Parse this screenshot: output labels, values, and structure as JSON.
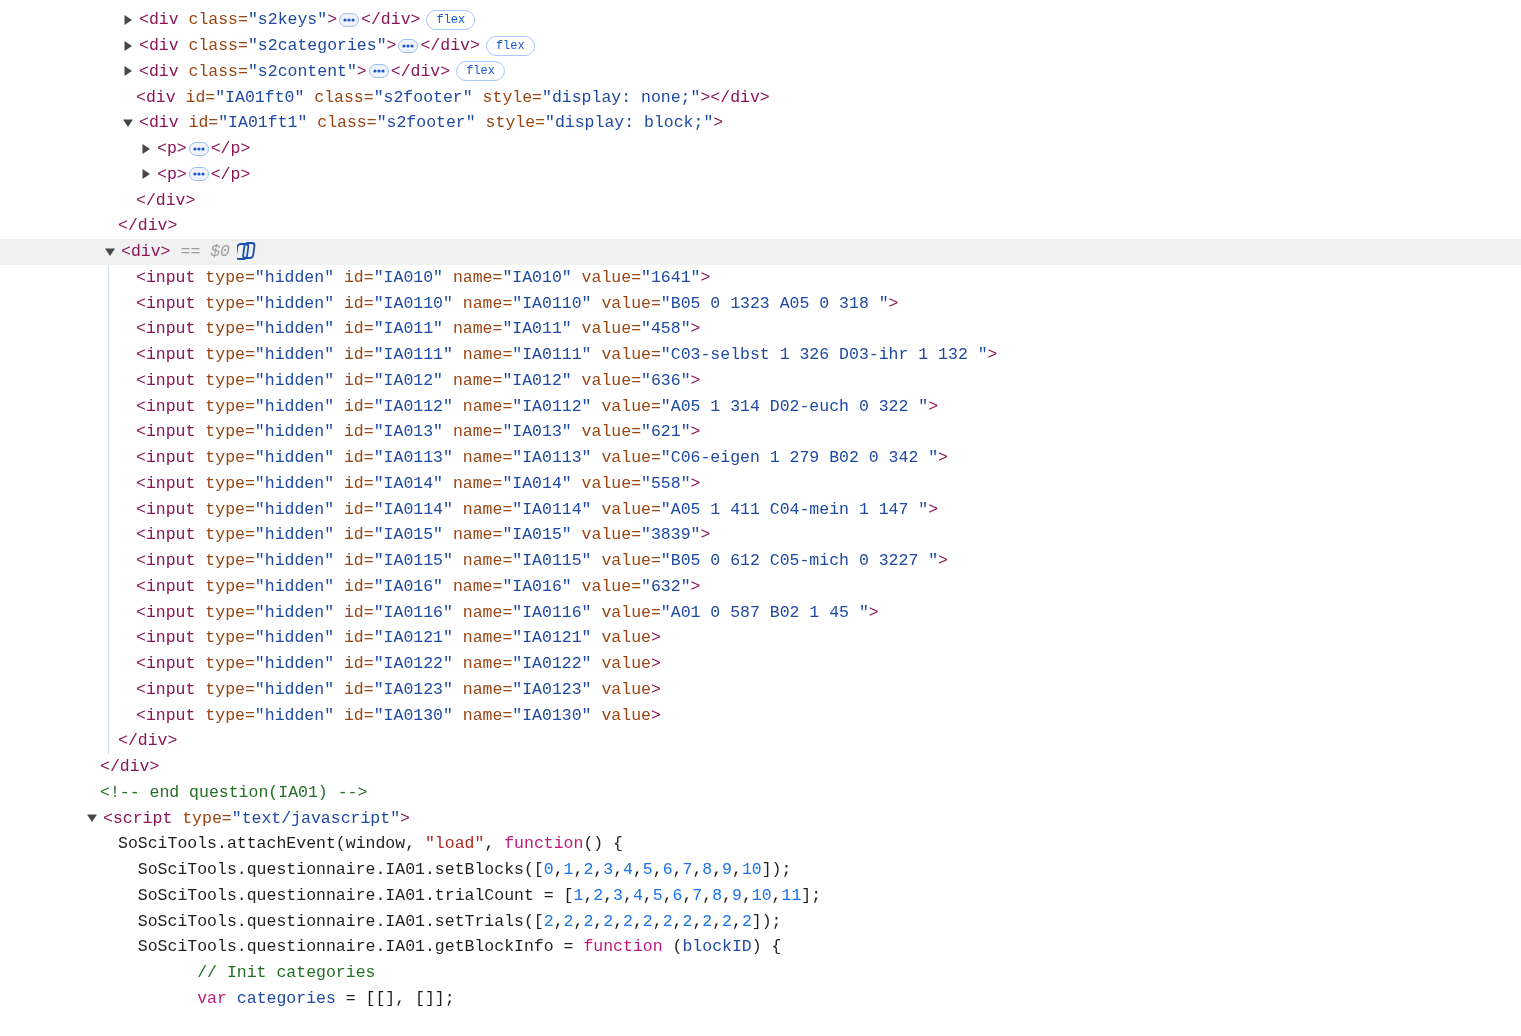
{
  "nodes": [
    {
      "kind": "fragment",
      "close": "</div>",
      "children": [
        {
          "kind": "fragment",
          "close": "</div>",
          "children": [
            {
              "kind": "element",
              "expanded": false,
              "selected": false,
              "open": "<div class=\"s2keys\">",
              "close": "</div>",
              "badge": "flex"
            },
            {
              "kind": "element",
              "expanded": false,
              "selected": false,
              "open": "<div class=\"s2categories\">",
              "close": "</div>",
              "badge": "flex"
            },
            {
              "kind": "element",
              "expanded": false,
              "selected": false,
              "open": "<div class=\"s2content\">",
              "close": "</div>",
              "badge": "flex"
            },
            {
              "kind": "leaf",
              "selected": false,
              "open": "<div id=\"IA01ft0\" class=\"s2footer\" style=\"display: none;\">",
              "close": "</div>"
            },
            {
              "kind": "element",
              "expanded": true,
              "selected": false,
              "open": "<div id=\"IA01ft1\" class=\"s2footer\" style=\"display: block;\">",
              "close": "</div>",
              "children": [
                {
                  "kind": "element",
                  "expanded": false,
                  "selected": false,
                  "open": "<p>",
                  "close": "</p>"
                },
                {
                  "kind": "element",
                  "expanded": false,
                  "selected": false,
                  "open": "<p>",
                  "close": "</p>"
                }
              ]
            }
          ]
        },
        {
          "kind": "element",
          "expanded": true,
          "selected": true,
          "open": "<div>",
          "marker": "== $0",
          "close": "</div>",
          "children": [
            {
              "kind": "leaf",
              "selected": false,
              "open": "<input type=\"hidden\" id=\"IA010\" name=\"IA010\" value=\"1641\">"
            },
            {
              "kind": "leaf",
              "selected": false,
              "open": "<input type=\"hidden\" id=\"IA0110\" name=\"IA0110\" value=\"B05 0 1323 A05 0 318 \">"
            },
            {
              "kind": "leaf",
              "selected": false,
              "open": "<input type=\"hidden\" id=\"IA011\" name=\"IA011\" value=\"458\">"
            },
            {
              "kind": "leaf",
              "selected": false,
              "open": "<input type=\"hidden\" id=\"IA0111\" name=\"IA0111\" value=\"C03-selbst 1 326 D03-ihr 1 132 \">"
            },
            {
              "kind": "leaf",
              "selected": false,
              "open": "<input type=\"hidden\" id=\"IA012\" name=\"IA012\" value=\"636\">"
            },
            {
              "kind": "leaf",
              "selected": false,
              "open": "<input type=\"hidden\" id=\"IA0112\" name=\"IA0112\" value=\"A05 1 314 D02-euch 0 322 \">"
            },
            {
              "kind": "leaf",
              "selected": false,
              "open": "<input type=\"hidden\" id=\"IA013\" name=\"IA013\" value=\"621\">"
            },
            {
              "kind": "leaf",
              "selected": false,
              "open": "<input type=\"hidden\" id=\"IA0113\" name=\"IA0113\" value=\"C06-eigen 1 279 B02 0 342 \">"
            },
            {
              "kind": "leaf",
              "selected": false,
              "open": "<input type=\"hidden\" id=\"IA014\" name=\"IA014\" value=\"558\">"
            },
            {
              "kind": "leaf",
              "selected": false,
              "open": "<input type=\"hidden\" id=\"IA0114\" name=\"IA0114\" value=\"A05 1 411 C04-mein 1 147 \">"
            },
            {
              "kind": "leaf",
              "selected": false,
              "open": "<input type=\"hidden\" id=\"IA015\" name=\"IA015\" value=\"3839\">"
            },
            {
              "kind": "leaf",
              "selected": false,
              "open": "<input type=\"hidden\" id=\"IA0115\" name=\"IA0115\" value=\"B05 0 612 C05-mich 0 3227 \">"
            },
            {
              "kind": "leaf",
              "selected": false,
              "open": "<input type=\"hidden\" id=\"IA016\" name=\"IA016\" value=\"632\">"
            },
            {
              "kind": "leaf",
              "selected": false,
              "open": "<input type=\"hidden\" id=\"IA0116\" name=\"IA0116\" value=\"A01 0 587 B02 1 45 \">"
            },
            {
              "kind": "leaf",
              "selected": false,
              "open": "<input type=\"hidden\" id=\"IA0121\" name=\"IA0121\" value>"
            },
            {
              "kind": "leaf",
              "selected": false,
              "open": "<input type=\"hidden\" id=\"IA0122\" name=\"IA0122\" value>"
            },
            {
              "kind": "leaf",
              "selected": false,
              "open": "<input type=\"hidden\" id=\"IA0123\" name=\"IA0123\" value>"
            },
            {
              "kind": "leaf",
              "selected": false,
              "open": "<input type=\"hidden\" id=\"IA0130\" name=\"IA0130\" value>"
            }
          ]
        }
      ]
    },
    {
      "kind": "comment",
      "selected": false,
      "text": "<!-- end question(IA01) -->"
    },
    {
      "kind": "element",
      "expanded": true,
      "selected": false,
      "open": "<script type=\"text/javascript\">",
      "children": [
        {
          "kind": "code",
          "selected": false,
          "tokens": [
            {
              "kind": "plain",
              "text": "SoSciTools.attachEvent(window, "
            },
            {
              "kind": "string",
              "text": "\"load\""
            },
            {
              "kind": "plain",
              "text": ", "
            },
            {
              "kind": "keyword",
              "text": "function"
            },
            {
              "kind": "plain",
              "text": "() {"
            }
          ]
        },
        {
          "kind": "code",
          "selected": false,
          "tokens": [
            {
              "kind": "plain",
              "text": "  SoSciTools.questionnaire.IA01.setBlocks(["
            },
            {
              "kind": "numbers",
              "text": "0,1,2,3,4,5,6,7,8,9,10"
            },
            {
              "kind": "plain",
              "text": "]);"
            }
          ]
        },
        {
          "kind": "code",
          "selected": false,
          "tokens": [
            {
              "kind": "plain",
              "text": "  SoSciTools.questionnaire.IA01.trialCount = ["
            },
            {
              "kind": "numbers",
              "text": "1,2,3,4,5,6,7,8,9,10,11"
            },
            {
              "kind": "plain",
              "text": "];"
            }
          ]
        },
        {
          "kind": "code",
          "selected": false,
          "tokens": [
            {
              "kind": "plain",
              "text": "  SoSciTools.questionnaire.IA01.setTrials(["
            },
            {
              "kind": "numbers",
              "text": "2,2,2,2,2,2,2,2,2,2,2"
            },
            {
              "kind": "plain",
              "text": "]);"
            }
          ]
        },
        {
          "kind": "code",
          "selected": false,
          "tokens": [
            {
              "kind": "plain",
              "text": "  SoSciTools.questionnaire.IA01.getBlockInfo = "
            },
            {
              "kind": "keyword",
              "text": "function"
            },
            {
              "kind": "plain",
              "text": " ("
            },
            {
              "kind": "ident",
              "text": "blockID"
            },
            {
              "kind": "plain",
              "text": ") {"
            }
          ]
        },
        {
          "kind": "code",
          "selected": false,
          "tokens": [
            {
              "kind": "comment",
              "text": "        // Init categories"
            }
          ]
        },
        {
          "kind": "code",
          "selected": false,
          "tokens": [
            {
              "kind": "keyword",
              "text": "        var"
            },
            {
              "kind": "ident",
              "text": " categories"
            },
            {
              "kind": "plain",
              "text": " = [[], []];"
            }
          ]
        }
      ]
    }
  ]
}
